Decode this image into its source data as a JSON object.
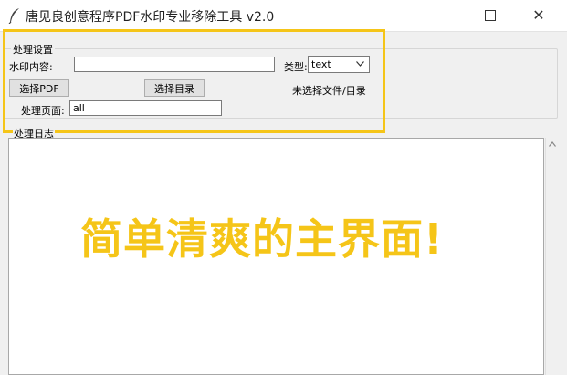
{
  "window": {
    "title": "唐见良创意程序PDF水印专业移除工具 v2.0",
    "close_glyph": "✕"
  },
  "settings": {
    "group_title": "处理设置",
    "watermark_label": "水印内容:",
    "watermark_value": "",
    "type_label": "类型:",
    "type_value": "text",
    "select_pdf_label": "选择PDF",
    "select_dir_label": "选择目录",
    "status_text": "未选择文件/目录",
    "pages_label": "处理页面:",
    "pages_value": "all"
  },
  "log": {
    "group_title": "处理日志"
  },
  "overlay": {
    "caption": "简单清爽的主界面!",
    "color": "#f5c518"
  }
}
